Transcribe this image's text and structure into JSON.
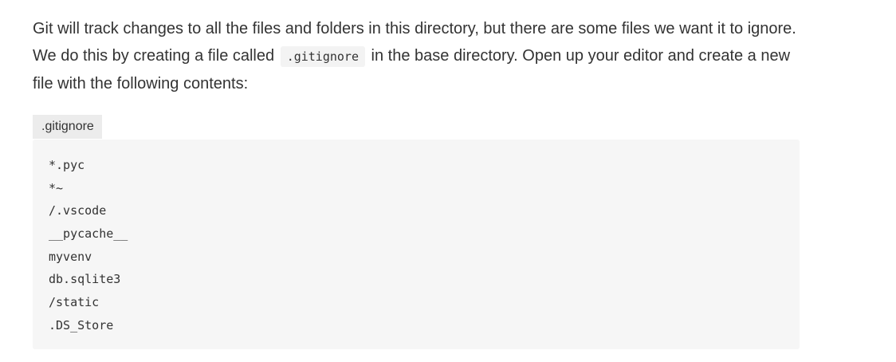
{
  "paragraph": {
    "text_before": "Git will track changes to all the files and folders in this directory, but there are some files we want it to ignore. We do this by creating a file called ",
    "inline_code": ".gitignore",
    "text_after": " in the base directory. Open up your editor and create a new file with the following contents:"
  },
  "code_file": {
    "filename": ".gitignore",
    "lines": [
      "*.pyc",
      "*~",
      "/.vscode",
      "__pycache__",
      "myvenv",
      "db.sqlite3",
      "/static",
      ".DS_Store"
    ]
  }
}
